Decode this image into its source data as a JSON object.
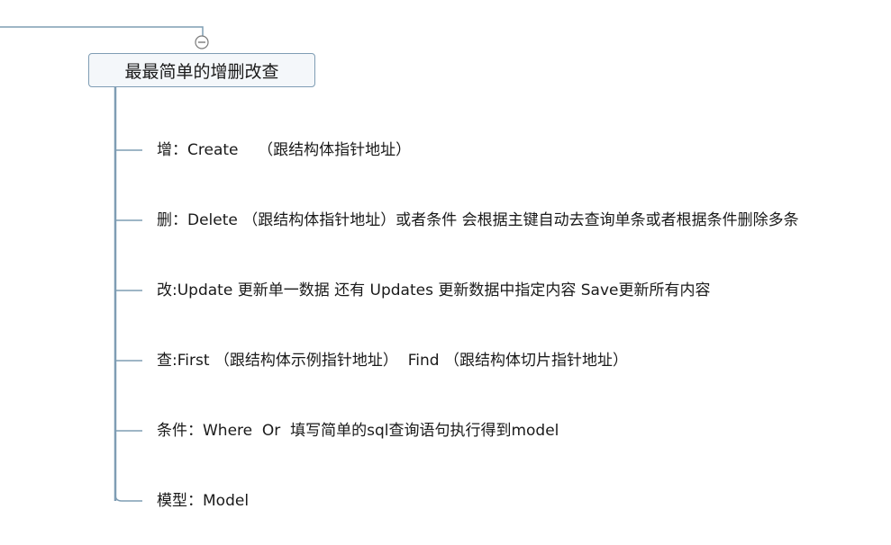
{
  "central_topic": {
    "label": "最最简单的增删改查"
  },
  "branches": [
    {
      "label": "增：Create    （跟结构体指针地址）"
    },
    {
      "label": "删：Delete （跟结构体指针地址）或者条件 会根据主键自动去查询单条或者根据条件删除多条"
    },
    {
      "label": "改:Update 更新单一数据 还有 Updates 更新数据中指定内容 Save更新所有内容"
    },
    {
      "label": "查:First （跟结构体示例指针地址）  Find （跟结构体切片指针地址）"
    },
    {
      "label": "条件：Where  Or  填写简单的sql查询语句执行得到model"
    },
    {
      "label": "模型：Model"
    }
  ],
  "colors": {
    "connector": "#7f9db4",
    "topic_border": "#7f9db4",
    "topic_fill": "#f4f7fa",
    "text": "#1a1a1a"
  },
  "icons": {
    "collapse_toggle": "minus-circle-icon"
  }
}
